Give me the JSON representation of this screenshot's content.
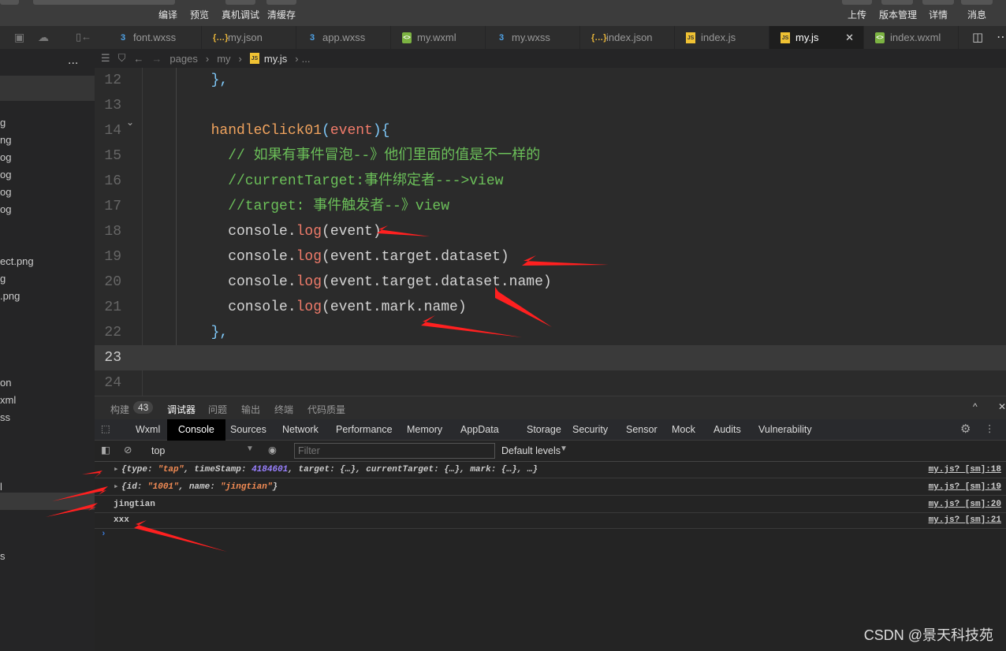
{
  "toolbar": {
    "left": [
      "编译",
      "预览",
      "真机调试",
      "清缓存"
    ],
    "right": [
      "上传",
      "版本管理",
      "详情",
      "消息"
    ]
  },
  "tabs": [
    {
      "label": "font.wxss",
      "icon": "css"
    },
    {
      "label": "my.json",
      "icon": "json"
    },
    {
      "label": "app.wxss",
      "icon": "css"
    },
    {
      "label": "my.wxml",
      "icon": "wxml"
    },
    {
      "label": "my.wxss",
      "icon": "css"
    },
    {
      "label": "index.json",
      "icon": "json"
    },
    {
      "label": "index.js",
      "icon": "js"
    },
    {
      "label": "my.js",
      "icon": "js",
      "active": true
    },
    {
      "label": "index.wxml",
      "icon": "wxml"
    }
  ],
  "sidebar": {
    "more": "...",
    "items": [
      "g",
      "ng",
      "og",
      "og",
      "og",
      "og",
      "ect.png",
      "g",
      ".png",
      "on",
      "xml",
      "ss",
      "l",
      "s"
    ]
  },
  "breadcrumb": [
    "pages",
    "my",
    "my.js",
    "..."
  ],
  "editor": {
    "current_line": 23,
    "lines": [
      {
        "n": "12",
        "tokens": [
          [
            "t-punc",
            "  },"
          ]
        ]
      },
      {
        "n": "13",
        "tokens": []
      },
      {
        "n": "14",
        "tokens": [
          [
            "t-fn",
            "  handleClick01"
          ],
          [
            "t-punc",
            "("
          ],
          [
            "t-param",
            "event"
          ],
          [
            "t-punc",
            "){"
          ]
        ]
      },
      {
        "n": "15",
        "tokens": [
          [
            "t-cm",
            "    // 如果有事件冒泡--》他们里面的值是不一样的"
          ]
        ]
      },
      {
        "n": "16",
        "tokens": [
          [
            "t-cm",
            "    //currentTarget:事件绑定者--->view"
          ]
        ]
      },
      {
        "n": "17",
        "tokens": [
          [
            "t-cm",
            "    //target: 事件触发者--》view"
          ]
        ]
      },
      {
        "n": "18",
        "tokens": [
          [
            "t-id",
            "    console."
          ],
          [
            "t-method",
            "log"
          ],
          [
            "t-id",
            "(event)"
          ]
        ]
      },
      {
        "n": "19",
        "tokens": [
          [
            "t-id",
            "    console."
          ],
          [
            "t-method",
            "log"
          ],
          [
            "t-id",
            "(event.target.dataset)"
          ]
        ]
      },
      {
        "n": "20",
        "tokens": [
          [
            "t-id",
            "    console."
          ],
          [
            "t-method",
            "log"
          ],
          [
            "t-id",
            "(event.target.dataset.name)"
          ]
        ]
      },
      {
        "n": "21",
        "tokens": [
          [
            "t-id",
            "    console."
          ],
          [
            "t-method",
            "log"
          ],
          [
            "t-id",
            "(event.mark.name)"
          ]
        ]
      },
      {
        "n": "22",
        "tokens": [
          [
            "t-punc",
            "  },"
          ]
        ]
      },
      {
        "n": "23",
        "tokens": []
      },
      {
        "n": "24",
        "tokens": []
      }
    ]
  },
  "devtools": {
    "panel_tabs": [
      "构建",
      "调试器",
      "问题",
      "输出",
      "终端",
      "代码质量"
    ],
    "build_badge": "43",
    "tabs": [
      "Wxml",
      "Console",
      "Sources",
      "Network",
      "Performance",
      "Memory",
      "AppData",
      "Storage",
      "Security",
      "Sensor",
      "Mock",
      "Audits",
      "Vulnerability"
    ],
    "context": "top",
    "filter_placeholder": "Filter",
    "levels": "Default levels"
  },
  "console": [
    {
      "parts": [
        [
          "k",
          "{type: "
        ],
        [
          "s",
          "\"tap\""
        ],
        [
          "k",
          ", timeStamp: "
        ],
        [
          "n",
          "4184601"
        ],
        [
          "k",
          ", target: {…}, currentTarget: {…}, mark: {…}, …}"
        ]
      ],
      "src": "my.js? [sm]:18",
      "expand": true
    },
    {
      "parts": [
        [
          "k",
          "{id: "
        ],
        [
          "s",
          "\"1001\""
        ],
        [
          "k",
          ", name: "
        ],
        [
          "s",
          "\"jingtian\""
        ],
        [
          "k",
          "}"
        ]
      ],
      "src": "my.js? [sm]:19",
      "expand": true
    },
    {
      "parts": [
        [
          "k",
          "jingtian"
        ]
      ],
      "src": "my.js? [sm]:20",
      "plain": true
    },
    {
      "parts": [
        [
          "k",
          "xxx"
        ]
      ],
      "src": "my.js? [sm]:21",
      "plain": true
    }
  ],
  "watermark": "CSDN @景天科技苑"
}
